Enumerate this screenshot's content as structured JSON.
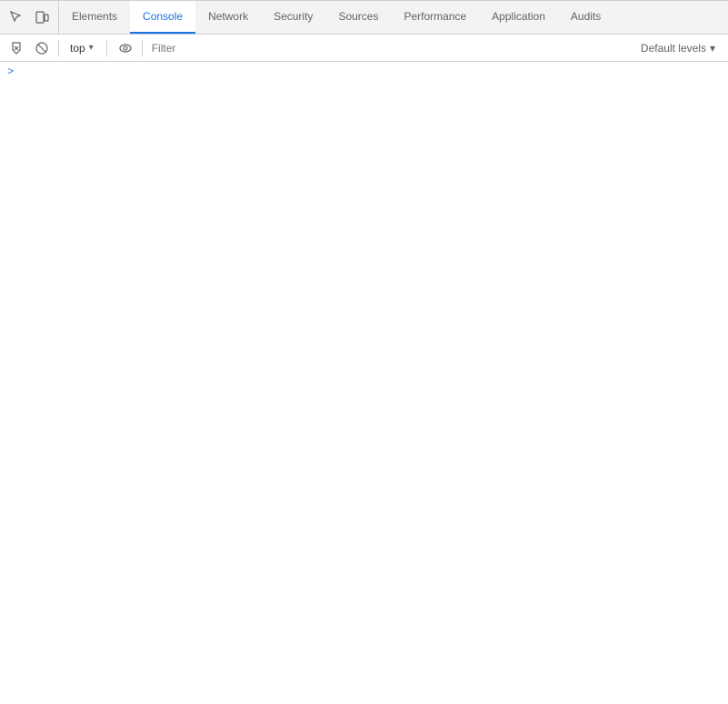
{
  "tabs": {
    "items": [
      {
        "id": "elements",
        "label": "Elements",
        "active": false
      },
      {
        "id": "console",
        "label": "Console",
        "active": true
      },
      {
        "id": "network",
        "label": "Network",
        "active": false
      },
      {
        "id": "security",
        "label": "Security",
        "active": false
      },
      {
        "id": "sources",
        "label": "Sources",
        "active": false
      },
      {
        "id": "performance",
        "label": "Performance",
        "active": false
      },
      {
        "id": "application",
        "label": "Application",
        "active": false
      },
      {
        "id": "audits",
        "label": "Audits",
        "active": false
      }
    ]
  },
  "toolbar": {
    "context_value": "top",
    "context_placeholder": "top",
    "filter_placeholder": "Filter",
    "levels_label": "Default levels",
    "levels_arrow": "▾"
  },
  "console": {
    "prompt_symbol": ">"
  }
}
